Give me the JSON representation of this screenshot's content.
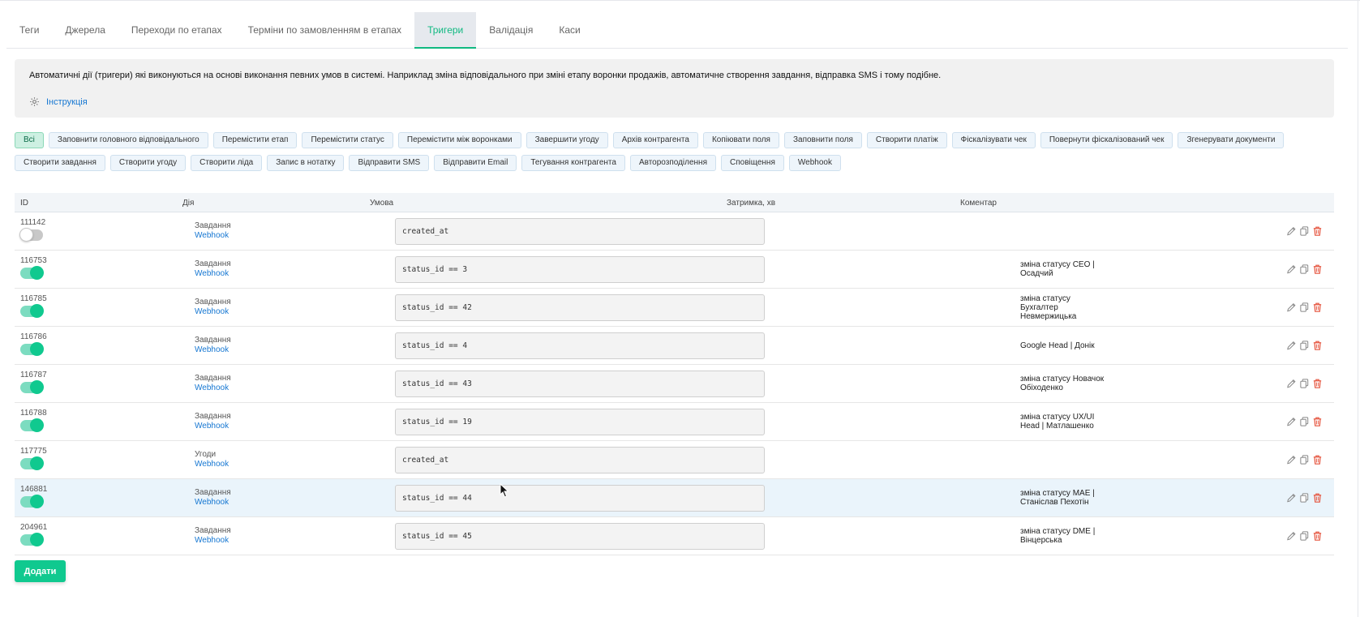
{
  "tabs": [
    "Теги",
    "Джерела",
    "Переходи по етапах",
    "Терміни по замовленням в етапах",
    "Тригери",
    "Валідація",
    "Каси"
  ],
  "active_tab": "Тригери",
  "info": {
    "text": "Автоматичні дії (тригери) які виконуються на основі виконання певних умов в системі. Наприклад зміна відповідального при зміні етапу воронки продажів, автоматичне створення завдання, відправка SMS і тому подібне.",
    "link": "Інструкція"
  },
  "chips_row1": [
    "Всі",
    "Заповнити головного відповідального",
    "Перемістити етап",
    "Перемістити статус",
    "Перемістити між воронками",
    "Завершити угоду",
    "Архів контрагента",
    "Копіювати поля",
    "Заповнити поля",
    "Створити платіж",
    "Фіскалізувати чек",
    "Повернути фіскалізований чек",
    "Згенерувати документи"
  ],
  "chips_row2": [
    "Створити завдання",
    "Створити угоду",
    "Створити ліда",
    "Запис в нотатку",
    "Відправити SMS",
    "Відправити Email",
    "Тегування контрагента",
    "Авторозподілення",
    "Сповіщення",
    "Webhook"
  ],
  "active_chip": "Всі",
  "table": {
    "headers": [
      "ID",
      "Дія",
      "Умова",
      "Затримка, хв",
      "Коментар"
    ],
    "rows": [
      {
        "id": "111142",
        "enabled": false,
        "type": "Завдання",
        "action": "Webhook",
        "condition": "created_at",
        "delay": "",
        "comment": ""
      },
      {
        "id": "116753",
        "enabled": true,
        "type": "Завдання",
        "action": "Webhook",
        "condition": "status_id == 3",
        "delay": "",
        "comment": "зміна статусу CEO |\nОсадчий"
      },
      {
        "id": "116785",
        "enabled": true,
        "type": "Завдання",
        "action": "Webhook",
        "condition": "status_id == 42",
        "delay": "",
        "comment": "зміна статусу\nБухгалтер\nНевмержицька"
      },
      {
        "id": "116786",
        "enabled": true,
        "type": "Завдання",
        "action": "Webhook",
        "condition": "status_id == 4",
        "delay": "",
        "comment": "Google Head | Донік"
      },
      {
        "id": "116787",
        "enabled": true,
        "type": "Завдання",
        "action": "Webhook",
        "condition": "status_id == 43",
        "delay": "",
        "comment": "зміна статусу Новачок\nОбіходенко"
      },
      {
        "id": "116788",
        "enabled": true,
        "type": "Завдання",
        "action": "Webhook",
        "condition": "status_id == 19",
        "delay": "",
        "comment": "зміна статусу UX/UI\nHead | Матлашенко"
      },
      {
        "id": "117775",
        "enabled": true,
        "type": "Угоди",
        "action": "Webhook",
        "condition": "created_at",
        "delay": "",
        "comment": ""
      },
      {
        "id": "146881",
        "enabled": true,
        "type": "Завдання",
        "action": "Webhook",
        "condition": "status_id == 44",
        "delay": "",
        "comment": "зміна статусу MAE |\nСтаніслав Пехотін"
      },
      {
        "id": "204961",
        "enabled": true,
        "type": "Завдання",
        "action": "Webhook",
        "condition": "status_id == 45",
        "delay": "",
        "comment": "зміна статусу DME |\nВінцерська"
      }
    ]
  },
  "add_button": "Додати",
  "colors": {
    "accent": "#10c98f",
    "link": "#1677d2",
    "delete": "#e5533d"
  },
  "row_action_icons": [
    "pencil-icon",
    "copy-icon",
    "trash-icon"
  ]
}
